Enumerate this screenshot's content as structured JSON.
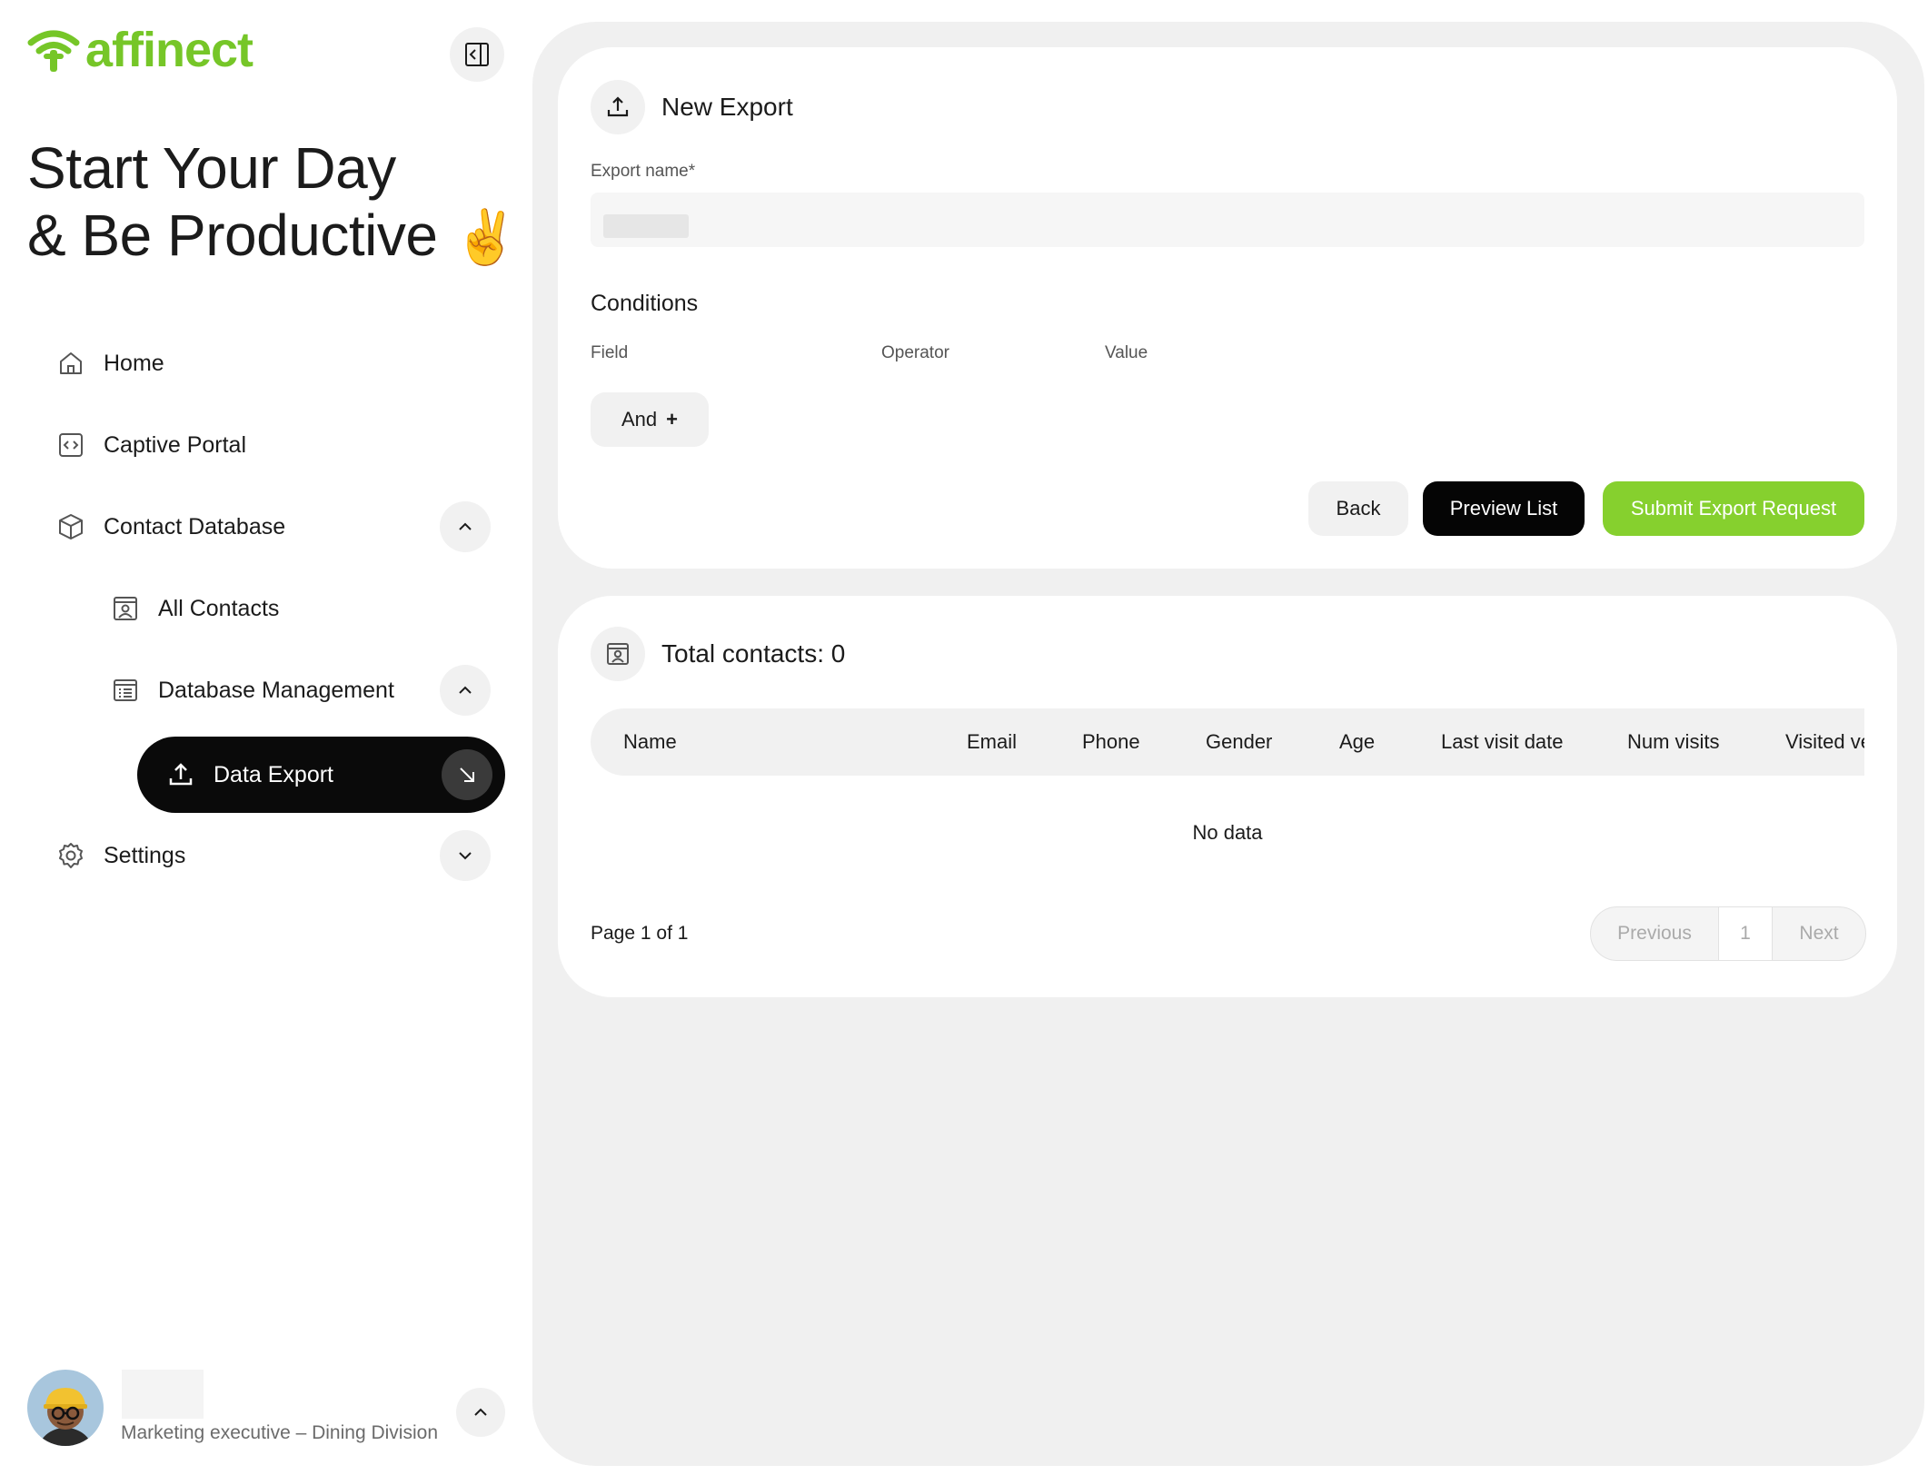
{
  "brand": {
    "name": "affinect",
    "color": "#76c628"
  },
  "greeting": {
    "line1": "Start Your Day",
    "line2": "& Be Productive",
    "emoji": "✌️"
  },
  "sidebar": {
    "items": [
      {
        "label": "Home",
        "icon": "home-icon"
      },
      {
        "label": "Captive Portal",
        "icon": "code-square-icon"
      },
      {
        "label": "Contact Database",
        "icon": "cube-icon",
        "expanded": true
      },
      {
        "label": "All Contacts",
        "icon": "contact-card-icon"
      },
      {
        "label": "Database Management",
        "icon": "list-document-icon",
        "expanded": true
      },
      {
        "label": "Data Export",
        "icon": "upload-icon",
        "active": true
      },
      {
        "label": "Settings",
        "icon": "gear-icon",
        "expanded": false
      }
    ]
  },
  "profile": {
    "role": "Marketing executive – Dining Division"
  },
  "export_form": {
    "title": "New Export",
    "export_name_label": "Export name*",
    "export_name_value": "",
    "conditions_title": "Conditions",
    "columns": {
      "field": "Field",
      "operator": "Operator",
      "value": "Value"
    },
    "and_button": "And",
    "and_icon": "+",
    "buttons": {
      "back": "Back",
      "preview": "Preview List",
      "submit": "Submit Export Request"
    }
  },
  "contacts": {
    "title": "Total contacts: 0",
    "headers": [
      "Name",
      "Email",
      "Phone",
      "Gender",
      "Age",
      "Last visit date",
      "Num visits",
      "Visited ve"
    ],
    "empty_text": "No data",
    "page_info": "Page 1 of 1",
    "pager": {
      "previous": "Previous",
      "current": "1",
      "next": "Next"
    }
  }
}
